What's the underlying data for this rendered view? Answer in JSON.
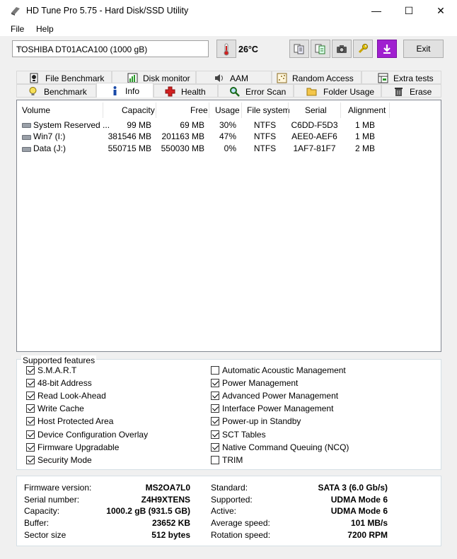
{
  "window": {
    "title": "HD Tune Pro 5.75 - Hard Disk/SSD Utility",
    "minimize": "—",
    "maximize": "☐",
    "close": "✕"
  },
  "menu": {
    "file": "File",
    "help": "Help"
  },
  "toolbar": {
    "drive": "TOSHIBA DT01ACA100 (1000 gB)",
    "temperature": "26°C",
    "exit": "Exit"
  },
  "tabs_top": [
    "File Benchmark",
    "Disk monitor",
    "AAM",
    "Random Access",
    "Extra tests"
  ],
  "tabs_bottom": [
    "Benchmark",
    "Info",
    "Health",
    "Error Scan",
    "Folder Usage",
    "Erase"
  ],
  "active_tab": "Info",
  "volume_table": {
    "headers": [
      "Volume",
      "Capacity",
      "Free",
      "Usage",
      "File system",
      "Serial",
      "Alignment"
    ],
    "rows": [
      [
        "System Reserved ...",
        "99 MB",
        "69 MB",
        "30%",
        "NTFS",
        "C6DD-F5D3",
        "1 MB"
      ],
      [
        "Win7 (I:)",
        "381546 MB",
        "201163 MB",
        "47%",
        "NTFS",
        "AEE0-AEF6",
        "1 MB"
      ],
      [
        "Data (J:)",
        "550715 MB",
        "550030 MB",
        "0%",
        "NTFS",
        "1AF7-81F7",
        "2 MB"
      ]
    ]
  },
  "features": {
    "title": "Supported features",
    "left": [
      {
        "label": "S.M.A.R.T",
        "checked": true
      },
      {
        "label": "48-bit Address",
        "checked": true
      },
      {
        "label": "Read Look-Ahead",
        "checked": true
      },
      {
        "label": "Write Cache",
        "checked": true
      },
      {
        "label": "Host Protected Area",
        "checked": true
      },
      {
        "label": "Device Configuration Overlay",
        "checked": true
      },
      {
        "label": "Firmware Upgradable",
        "checked": true
      },
      {
        "label": "Security Mode",
        "checked": true
      }
    ],
    "right": [
      {
        "label": "Automatic Acoustic Management",
        "checked": false
      },
      {
        "label": "Power Management",
        "checked": true
      },
      {
        "label": "Advanced Power Management",
        "checked": true
      },
      {
        "label": "Interface Power Management",
        "checked": true
      },
      {
        "label": "Power-up in Standby",
        "checked": true
      },
      {
        "label": "SCT Tables",
        "checked": true
      },
      {
        "label": "Native Command Queuing (NCQ)",
        "checked": true
      },
      {
        "label": "TRIM",
        "checked": false
      }
    ]
  },
  "info": {
    "left": [
      {
        "label": "Firmware version:",
        "value": "MS2OA7L0"
      },
      {
        "label": "Serial number:",
        "value": "Z4H9XTENS"
      },
      {
        "label": "Capacity:",
        "value": "1000.2 gB (931.5 GB)"
      },
      {
        "label": "Buffer:",
        "value": "23652 KB"
      },
      {
        "label": "Sector size",
        "value": "512 bytes"
      }
    ],
    "right": [
      {
        "label": "Standard:",
        "value": "SATA 3 (6.0 Gb/s)"
      },
      {
        "label": "Supported:",
        "value": "UDMA Mode 6"
      },
      {
        "label": "Active:",
        "value": "UDMA Mode 6"
      },
      {
        "label": "Average speed:",
        "value": "101 MB/s"
      },
      {
        "label": "Rotation speed:",
        "value": "7200 RPM"
      }
    ]
  },
  "colors": {
    "accent_purple": "#a020d0",
    "thermo_red": "#d22020"
  }
}
